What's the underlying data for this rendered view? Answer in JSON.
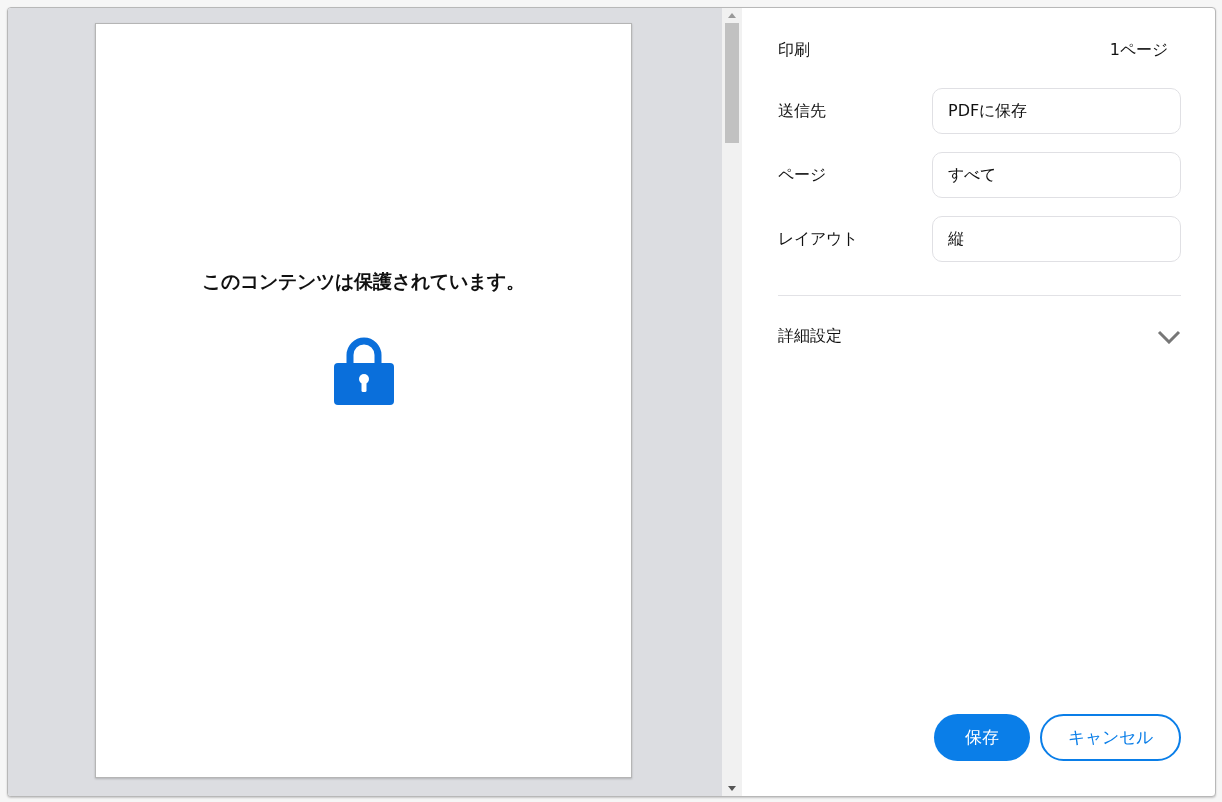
{
  "preview": {
    "message": "このコンテンツは保護されています。"
  },
  "settings": {
    "title": "印刷",
    "page_count": "1ページ",
    "fields": [
      {
        "label": "送信先",
        "value": "PDFに保存"
      },
      {
        "label": "ページ",
        "value": "すべて"
      },
      {
        "label": "レイアウト",
        "value": "縦"
      }
    ],
    "advanced": {
      "label": "詳細設定",
      "expanded": false
    }
  },
  "buttons": [
    {
      "label": "保存",
      "kind": "primary"
    },
    {
      "label": "キャンセル",
      "kind": "secondary"
    }
  ]
}
